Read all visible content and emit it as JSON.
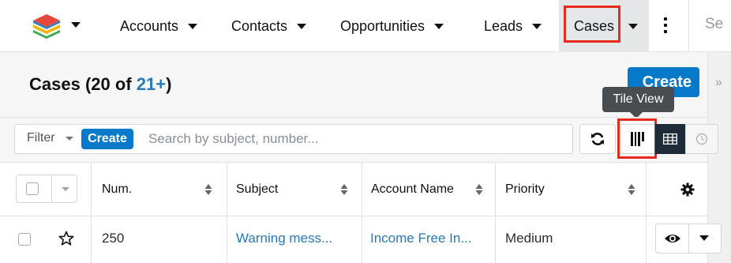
{
  "nav": {
    "items": [
      {
        "label": "Accounts"
      },
      {
        "label": "Contacts"
      },
      {
        "label": "Opportunities"
      },
      {
        "label": "Leads"
      },
      {
        "label": "Cases"
      }
    ],
    "search_partial": "Se"
  },
  "header": {
    "title": "Cases",
    "count_open": "(20 of ",
    "count_link": "21+",
    "count_close": ")",
    "create_label": "Create",
    "tooltip": "Tile View"
  },
  "filter": {
    "label": "Filter",
    "create_label": "Create",
    "search_placeholder": "Search by subject, number..."
  },
  "table": {
    "columns": [
      "Num.",
      "Subject",
      "Account Name",
      "Priority"
    ],
    "rows": [
      {
        "num": "250",
        "subject": "Warning mess...",
        "account": "Income Free In...",
        "priority": "Medium"
      }
    ]
  },
  "colors": {
    "accent": "#0679c8",
    "link": "#2779b8",
    "highlight": "#e9291d",
    "tooltip_bg": "#4a4d4f"
  },
  "icons": [
    "app-logo-icon",
    "kebab-icon",
    "refresh-icon",
    "tile-view-icon",
    "list-view-icon",
    "clock-icon",
    "gear-icon",
    "star-icon",
    "eye-icon"
  ]
}
